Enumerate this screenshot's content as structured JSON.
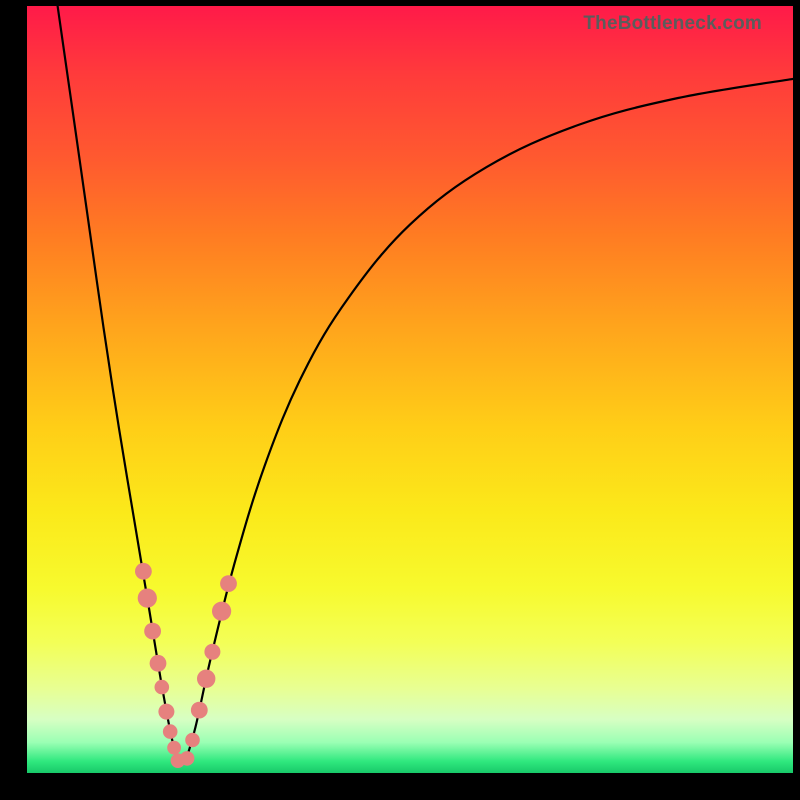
{
  "watermark": "TheBottleneck.com",
  "colors": {
    "frame": "#000000",
    "bead": "#e6817e",
    "curve": "#000000"
  },
  "chart_data": {
    "type": "line",
    "title": "",
    "xlabel": "",
    "ylabel": "",
    "xlim": [
      0,
      100
    ],
    "ylim": [
      0,
      100
    ],
    "note": "Axis values in % of plot area. y=0 at bottom. Single V-shaped curve with minimum near x≈20, left branch rising steeply to top-left, right branch rising asymptotically toward top-right. Small pink bead markers clustered near the minimum on both branches.",
    "series": [
      {
        "name": "left-branch",
        "x": [
          4.0,
          6.0,
          8.0,
          10.0,
          12.0,
          14.0,
          16.0,
          17.5,
          18.8,
          19.8
        ],
        "y": [
          100.0,
          86.0,
          72.0,
          58.0,
          45.0,
          33.0,
          21.0,
          12.0,
          5.0,
          1.2
        ]
      },
      {
        "name": "right-branch",
        "x": [
          20.6,
          22.0,
          24.0,
          27.0,
          31.0,
          36.0,
          42.0,
          50.0,
          60.0,
          72.0,
          85.0,
          100.0
        ],
        "y": [
          1.2,
          6.0,
          15.0,
          27.0,
          40.0,
          52.0,
          62.0,
          71.5,
          79.0,
          84.5,
          88.0,
          90.5
        ]
      }
    ],
    "beads_left": [
      {
        "x": 15.2,
        "y": 26.3,
        "r": 1.1
      },
      {
        "x": 15.7,
        "y": 22.8,
        "r": 1.25
      },
      {
        "x": 16.4,
        "y": 18.5,
        "r": 1.1
      },
      {
        "x": 17.1,
        "y": 14.3,
        "r": 1.1
      },
      {
        "x": 17.6,
        "y": 11.2,
        "r": 0.95
      },
      {
        "x": 18.2,
        "y": 8.0,
        "r": 1.05
      },
      {
        "x": 18.7,
        "y": 5.4,
        "r": 0.95
      },
      {
        "x": 19.2,
        "y": 3.3,
        "r": 0.9
      },
      {
        "x": 19.7,
        "y": 1.6,
        "r": 0.95
      }
    ],
    "beads_right": [
      {
        "x": 20.9,
        "y": 1.9,
        "r": 0.95
      },
      {
        "x": 21.6,
        "y": 4.3,
        "r": 0.95
      },
      {
        "x": 22.5,
        "y": 8.2,
        "r": 1.1
      },
      {
        "x": 23.4,
        "y": 12.3,
        "r": 1.2
      },
      {
        "x": 24.2,
        "y": 15.8,
        "r": 1.05
      },
      {
        "x": 25.4,
        "y": 21.1,
        "r": 1.25
      },
      {
        "x": 26.3,
        "y": 24.7,
        "r": 1.1
      }
    ]
  }
}
